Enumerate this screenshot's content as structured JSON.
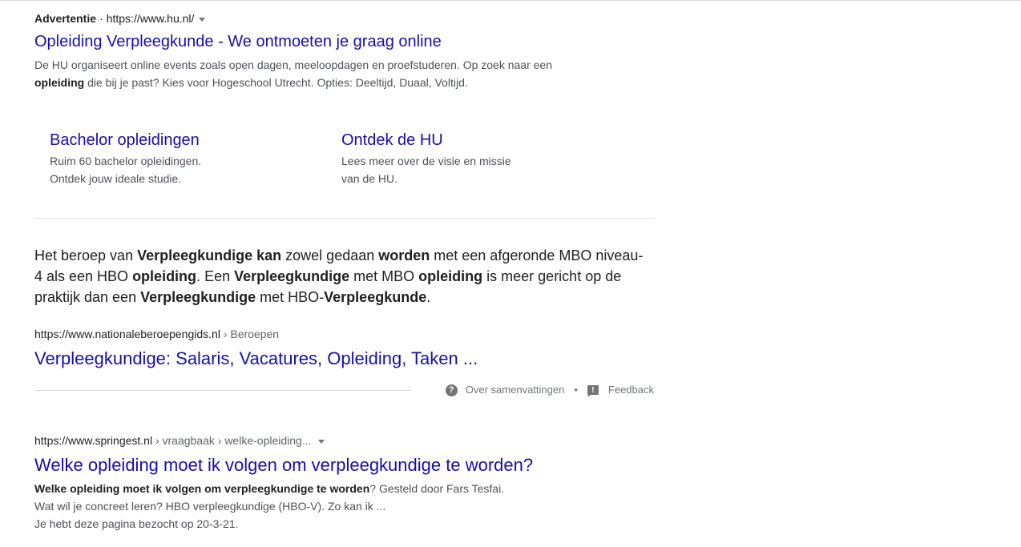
{
  "ad": {
    "label": "Advertentie",
    "separator": "·",
    "url": "https://www.hu.nl/",
    "title": "Opleiding Verpleegkunde - We ontmoeten je graag online",
    "desc_1": "De HU organiseert online events zoals open dagen, meeloopdagen en proefstuderen. Op zoek naar een ",
    "desc_bold": "opleiding",
    "desc_2": " die bij je past? Kies voor Hogeschool Utrecht. Opties: Deeltijd, Duaal, Voltijd.",
    "sitelinks": [
      {
        "title": "Bachelor opleidingen",
        "line1": "Ruim 60 bachelor opleidingen.",
        "line2": "Ontdek jouw ideale studie."
      },
      {
        "title": "Ontdek de HU",
        "line1": "Lees meer over de visie en missie",
        "line2": "van de HU."
      }
    ]
  },
  "featured": {
    "parts": [
      {
        "t": "Het beroep van ",
        "b": false
      },
      {
        "t": "Verpleegkundige kan",
        "b": true
      },
      {
        "t": " zowel gedaan ",
        "b": false
      },
      {
        "t": "worden",
        "b": true
      },
      {
        "t": " met een afgeronde MBO niveau-4 als een HBO ",
        "b": false
      },
      {
        "t": "opleiding",
        "b": true
      },
      {
        "t": ". Een ",
        "b": false
      },
      {
        "t": "Verpleegkundige",
        "b": true
      },
      {
        "t": " met MBO ",
        "b": false
      },
      {
        "t": "opleiding",
        "b": true
      },
      {
        "t": " is meer gericht op de praktijk dan een ",
        "b": false
      },
      {
        "t": "Verpleegkundige",
        "b": true
      },
      {
        "t": " met HBO-",
        "b": false
      },
      {
        "t": "Verpleegkunde",
        "b": true
      },
      {
        "t": ".",
        "b": false
      }
    ],
    "url": "https://www.nationaleberoepengids.nl",
    "breadcrumb": " › Beroepen",
    "title": "Verpleegkundige: Salaris, Vacatures, Opleiding, Taken ...",
    "about_label": "Over samenvattingen",
    "dot": "•",
    "feedback_label": "Feedback"
  },
  "result": {
    "url": "https://www.springest.nl",
    "breadcrumb": " › vraagbaak › welke-opleiding...",
    "title": "Welke opleiding moet ik volgen om verpleegkundige te worden?",
    "snippet_bold": "Welke opleiding moet ik volgen om verpleegkundige te worden",
    "snippet_1": "? Gesteld door Fars Tesfai.",
    "snippet_2": "Wat wil je concreet leren? HBO verpleegkundige (HBO-V). Zo kan ik ...",
    "visited": "Je hebt deze pagina bezocht op 20-3-21."
  }
}
